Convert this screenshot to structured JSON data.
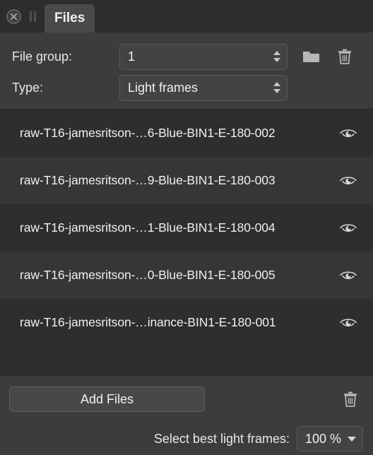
{
  "window": {
    "tab_label": "Files",
    "close_icon": "close-circle-icon",
    "pause_icon": "pause-icon"
  },
  "form": {
    "file_group": {
      "label": "File group:",
      "value": "1",
      "stepper_icon": "up-down-stepper-icon"
    },
    "type": {
      "label": "Type:",
      "value": "Light frames",
      "stepper_icon": "up-down-stepper-icon"
    },
    "folder_icon": "folder-icon",
    "trash_icon": "trash-icon"
  },
  "file_list": {
    "rows": [
      {
        "name": "raw-T16-jamesritson-…6-Blue-BIN1-E-180-002",
        "visibility_icon": "eye-icon"
      },
      {
        "name": "raw-T16-jamesritson-…9-Blue-BIN1-E-180-003",
        "visibility_icon": "eye-icon"
      },
      {
        "name": "raw-T16-jamesritson-…1-Blue-BIN1-E-180-004",
        "visibility_icon": "eye-icon"
      },
      {
        "name": "raw-T16-jamesritson-…0-Blue-BIN1-E-180-005",
        "visibility_icon": "eye-icon"
      },
      {
        "name": "raw-T16-jamesritson-…inance-BIN1-E-180-001",
        "visibility_icon": "eye-icon"
      }
    ]
  },
  "bottom": {
    "add_files_label": "Add Files",
    "trash_icon": "trash-icon",
    "select_best_label": "Select best light frames:",
    "percent_value": "100 %",
    "caret_icon": "chevron-down-icon"
  },
  "colors": {
    "window_bg": "#3c3c3c",
    "tabbar_bg": "#2d2d2d",
    "tab_active_bg": "#4a4a4a",
    "list_row_even": "#2e2e2e",
    "list_row_odd": "#363636",
    "text": "#f0f0f0",
    "field_bg": "#434343",
    "field_border": "#5a5a5a"
  }
}
